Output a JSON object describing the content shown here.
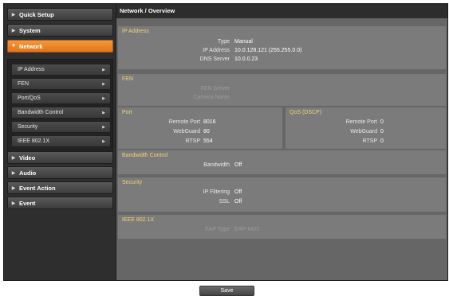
{
  "sidebar": {
    "groups": [
      {
        "label": "Quick Setup"
      },
      {
        "label": "System"
      },
      {
        "label": "Network"
      },
      {
        "label": "Video"
      },
      {
        "label": "Audio"
      },
      {
        "label": "Event Action"
      },
      {
        "label": "Event"
      }
    ],
    "network_items": [
      {
        "label": "IP Address"
      },
      {
        "label": "FEN"
      },
      {
        "label": "Port/QoS"
      },
      {
        "label": "Bandwidth Control"
      },
      {
        "label": "Security"
      },
      {
        "label": "IEEE 802.1X"
      }
    ]
  },
  "page": {
    "title": "Network / Overview"
  },
  "ip_address": {
    "title": "IP Address",
    "type_label": "Type",
    "type_value": "Manual",
    "ip_label": "IP Address",
    "ip_value": "10.0.128.121 (255.255.0.0)",
    "dns_label": "DNS Server",
    "dns_value": "10.0.0.23"
  },
  "fen": {
    "title": "FEN",
    "server_label": "FEN Server",
    "camera_label": "Camera Name"
  },
  "port": {
    "title": "Port",
    "remote_label": "Remote Port",
    "remote_value": "8016",
    "webguard_label": "WebGuard",
    "webguard_value": "80",
    "rtsp_label": "RTSP",
    "rtsp_value": "554"
  },
  "qos": {
    "title": "QoS (DSCP)",
    "remote_label": "Remote Port",
    "remote_value": "0",
    "webguard_label": "WebGuard",
    "webguard_value": "0",
    "rtsp_label": "RTSP",
    "rtsp_value": "0"
  },
  "bandwidth": {
    "title": "Bandwidth Control",
    "label": "Bandwidth",
    "value": "Off"
  },
  "security": {
    "title": "Security",
    "ipfilter_label": "IP Filtering",
    "ipfilter_value": "Off",
    "ssl_label": "SSL",
    "ssl_value": "Off"
  },
  "ieee": {
    "title": "IEEE 802.1X",
    "eap_label": "EAP Type",
    "eap_value": "EAP-MD5"
  },
  "footer": {
    "save_label": "Save"
  },
  "colors": {
    "accent": "#e8831f",
    "section_title": "#f0d27a"
  }
}
